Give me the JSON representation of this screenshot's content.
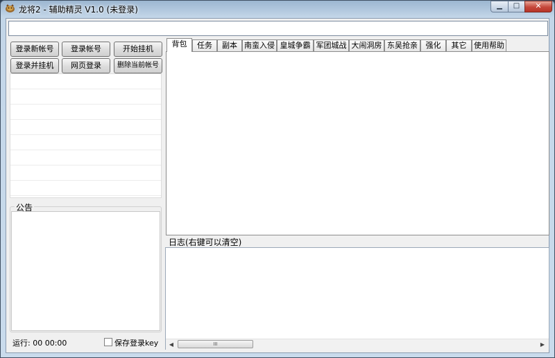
{
  "window": {
    "title": "龙将2 - 辅助精灵 V1.0 (未登录)"
  },
  "title_buttons": {
    "minimize": "▁",
    "maximize": "□",
    "close": "✕"
  },
  "top_input": {
    "value": "",
    "placeholder": ""
  },
  "buttons": {
    "login_new_account": "登录新帐号",
    "login_account": "登录帐号",
    "start_hangup": "开始挂机",
    "login_and_hangup": "登录并挂机",
    "web_login": "网页登录",
    "delete_current_account": "删除当前帐号"
  },
  "account_list": {
    "rows": [
      "",
      "",
      "",
      "",
      "",
      "",
      "",
      ""
    ]
  },
  "notice": {
    "title": "公告",
    "content": ""
  },
  "status": {
    "runtime": "运行: 00 00:00"
  },
  "save_login": {
    "label": "保存登录key",
    "checked": false
  },
  "tabs": [
    "背包",
    "任务",
    "副本",
    "南蛮入侵",
    "皇城争霸",
    "军团城战",
    "大闹洞房",
    "东吴抢亲",
    "强化",
    "其它",
    "使用帮助"
  ],
  "active_tab": "背包",
  "log": {
    "label": "日志(右键可以清空)",
    "content": ""
  },
  "scrollbar": {
    "left_arrow": "◀",
    "right_arrow": "▶",
    "thumb_grip": "III"
  }
}
